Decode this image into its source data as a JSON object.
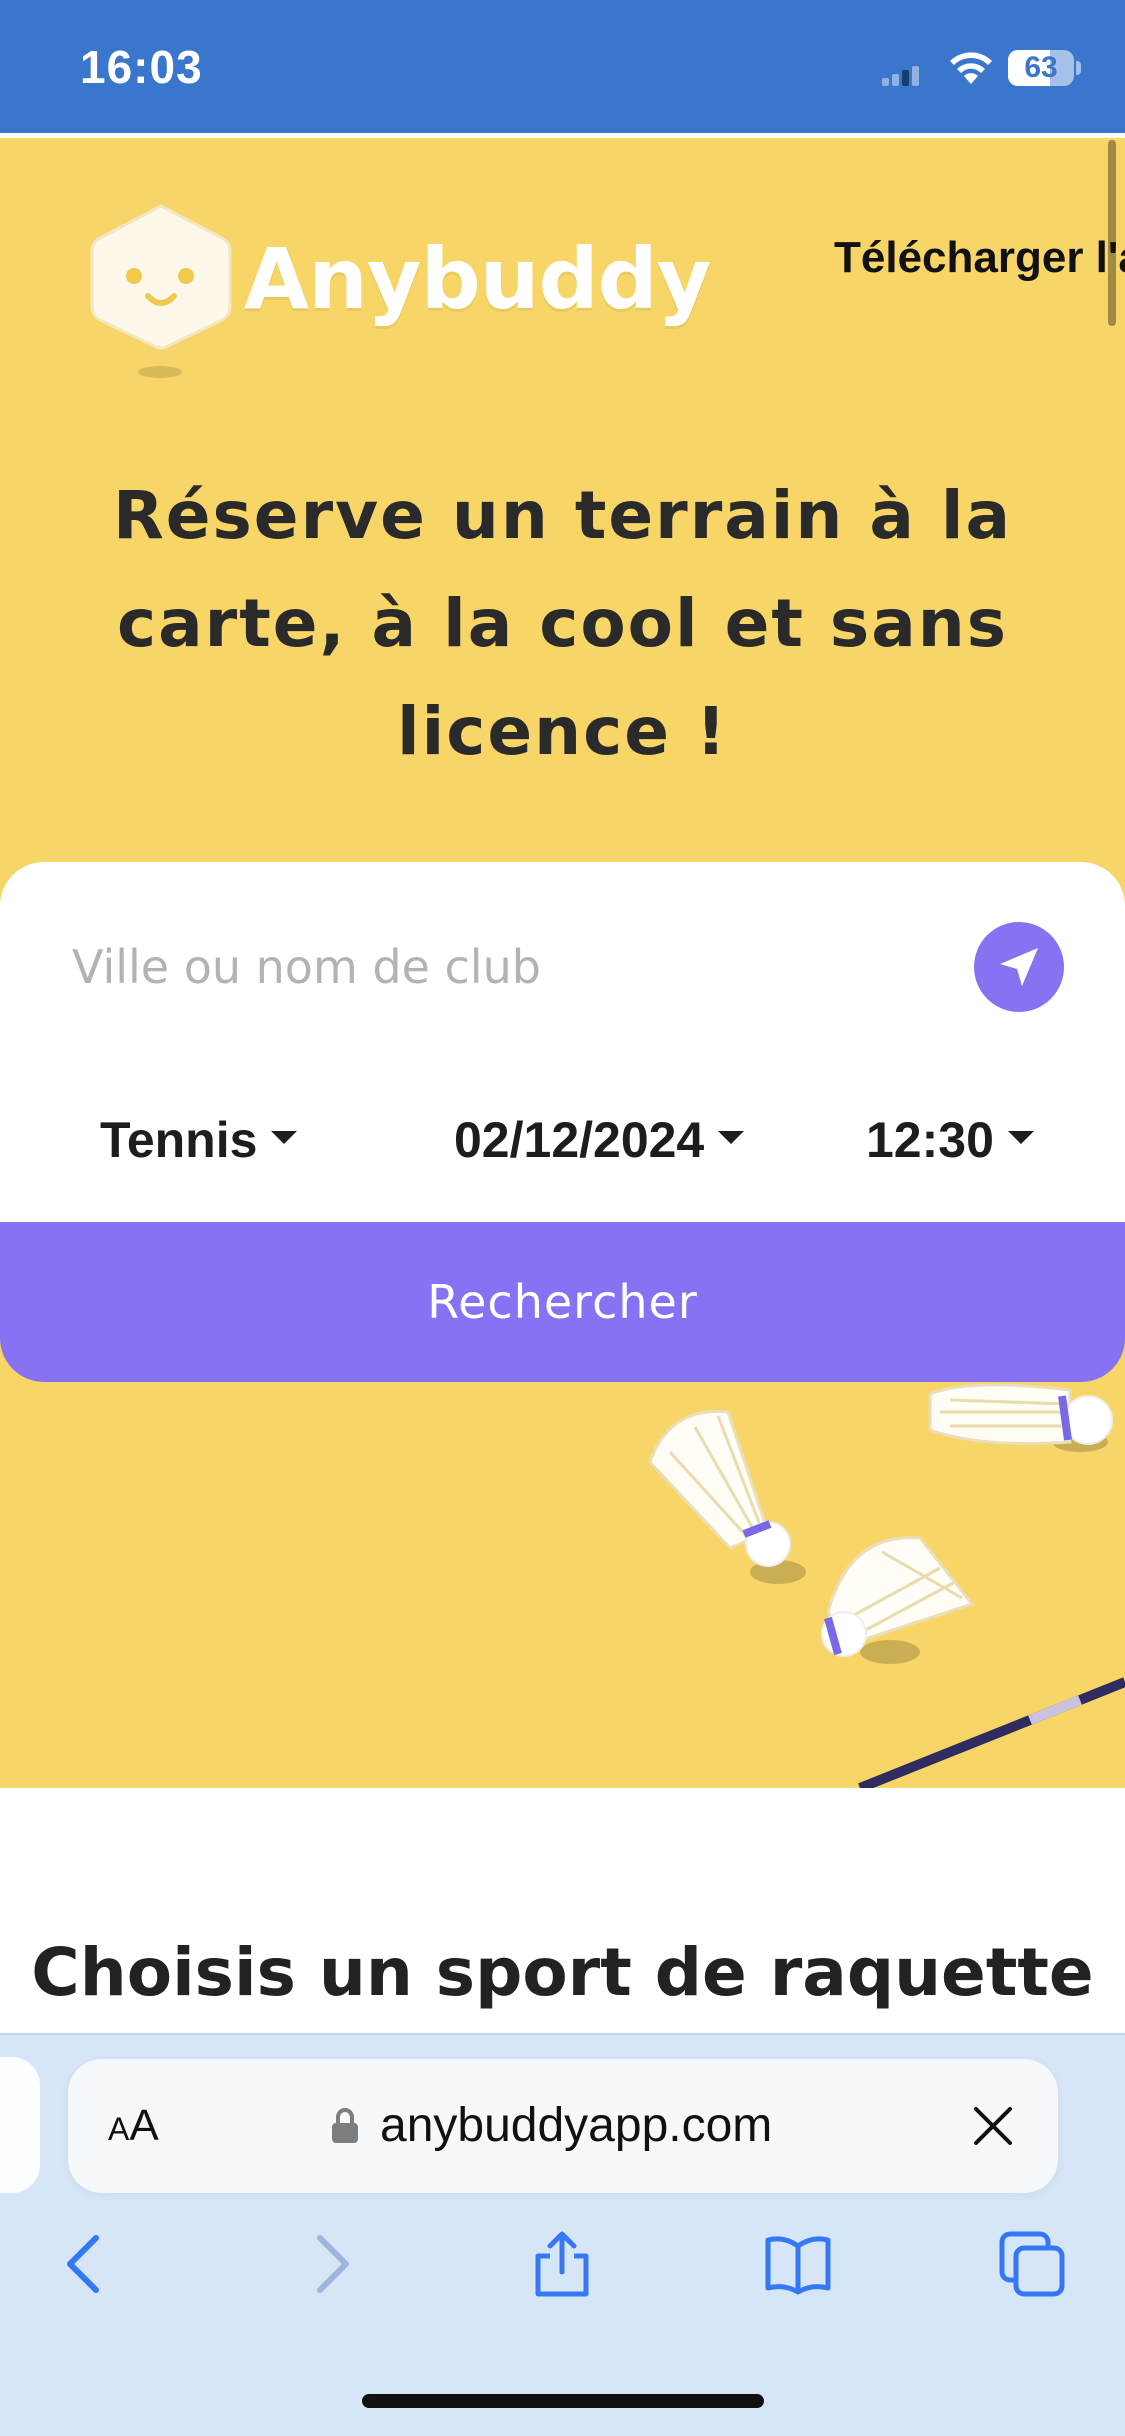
{
  "status_bar": {
    "time": "16:03",
    "battery": "63",
    "battery_level_percent": 63
  },
  "header": {
    "brand": "Anybuddy",
    "download_link_label": "Télécharger l'app"
  },
  "hero": {
    "headline": "Réserve un terrain à la carte, à la cool et sans licence !"
  },
  "search": {
    "placeholder": "Ville ou nom de club",
    "sport": "Tennis",
    "date": "02/12/2024",
    "time": "12:30",
    "button_label": "Rechercher"
  },
  "section": {
    "title": "Choisis un sport de raquette"
  },
  "browser": {
    "aa_label_small": "A",
    "aa_label_large": "A",
    "url": "anybuddyapp.com"
  },
  "icons": {
    "locate": "location-arrow-icon",
    "lock": "lock-icon",
    "clear": "close-icon",
    "back": "chevron-left-icon",
    "forward": "chevron-right-icon",
    "share": "share-icon",
    "bookmarks": "book-icon",
    "tabs": "tabs-icon"
  },
  "colors": {
    "status_bar": "#3a76cb",
    "hero_yellow": "#f7d566",
    "accent_purple": "#8772f4",
    "browser_bar": "#d7e6f7"
  }
}
